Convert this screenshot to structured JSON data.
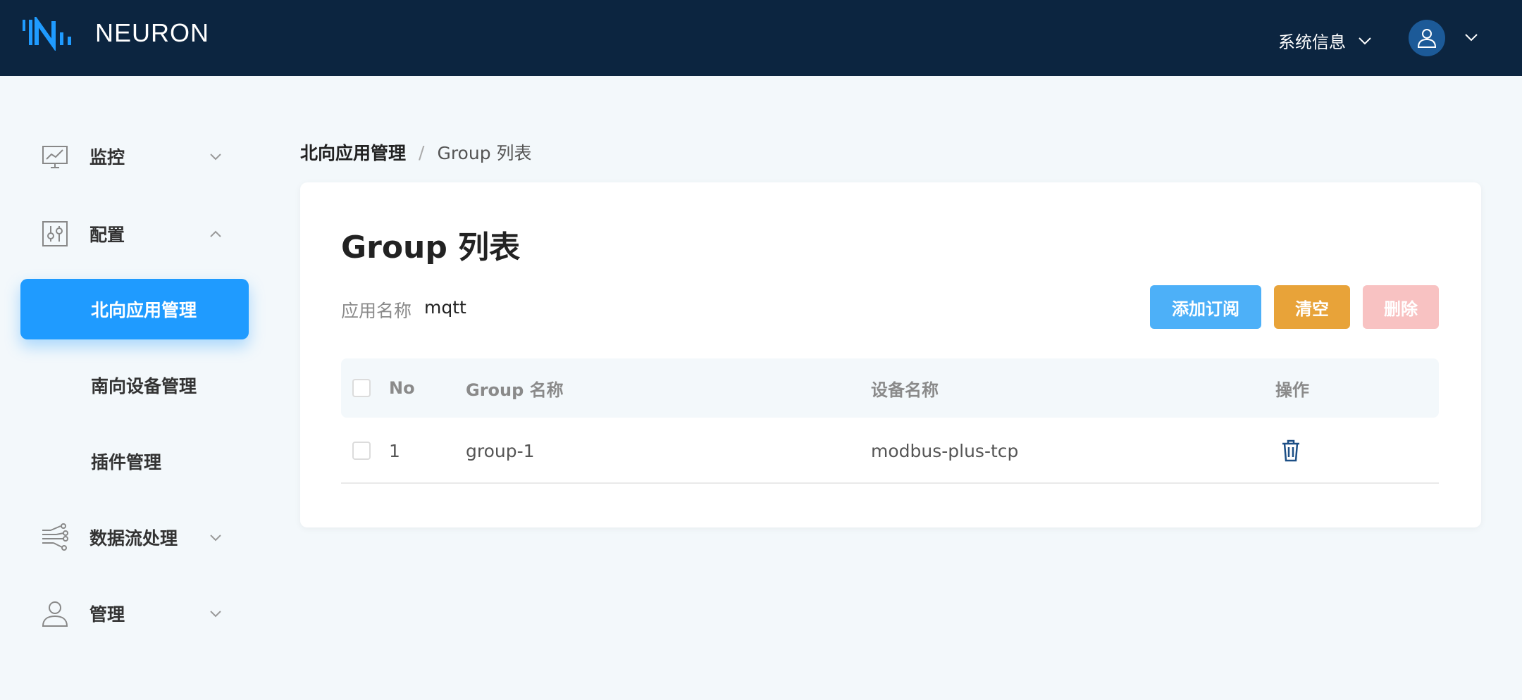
{
  "header": {
    "brand": "NEURON",
    "system_info": "系统信息"
  },
  "sidebar": {
    "items": [
      {
        "label": "监控",
        "icon": "monitor-chart-icon",
        "expanded": false
      },
      {
        "label": "配置",
        "icon": "config-sliders-icon",
        "expanded": true,
        "children": [
          {
            "label": "北向应用管理",
            "active": true
          },
          {
            "label": "南向设备管理",
            "active": false
          },
          {
            "label": "插件管理",
            "active": false
          }
        ]
      },
      {
        "label": "数据流处理",
        "icon": "dataflow-icon",
        "expanded": false
      },
      {
        "label": "管理",
        "icon": "user-icon",
        "expanded": false
      }
    ]
  },
  "breadcrumb": {
    "root": "北向应用管理",
    "separator": "/",
    "current": "Group 列表"
  },
  "main": {
    "title": "Group 列表",
    "app_label": "应用名称",
    "app_value": "mqtt",
    "buttons": {
      "add": "添加订阅",
      "clear": "清空",
      "delete": "删除"
    },
    "table": {
      "columns": [
        "No",
        "Group 名称",
        "设备名称",
        "操作"
      ],
      "rows": [
        {
          "no": "1",
          "group": "group-1",
          "device": "modbus-plus-tcp"
        }
      ]
    }
  },
  "colors": {
    "header_bg": "#0c2540",
    "accent": "#1f9bff",
    "add_button": "#4db0f8",
    "clear_button": "#e8a339",
    "delete_button_disabled": "#f8c2c2"
  }
}
